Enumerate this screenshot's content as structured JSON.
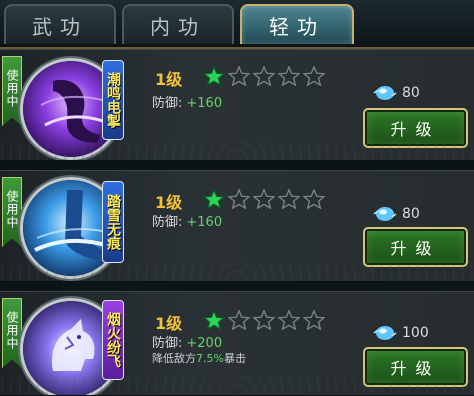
{
  "tabs": [
    {
      "label": "武功",
      "active": false
    },
    {
      "label": "内功",
      "active": false
    },
    {
      "label": "轻功",
      "active": true
    }
  ],
  "skills": [
    {
      "in_use_label": "使用中",
      "name": "潮鸣电掣",
      "level": "1级",
      "stars_filled": 1,
      "stars_total": 5,
      "stat_label": "防御:",
      "stat_value": "+160",
      "extra_prefix": "",
      "extra_percent": "",
      "extra_suffix": "",
      "cost": "80",
      "upgrade_label": "升级",
      "emblem_color": "#7a3fd0"
    },
    {
      "in_use_label": "使用中",
      "name": "踏雪无痕",
      "level": "1级",
      "stars_filled": 1,
      "stars_total": 5,
      "stat_label": "防御:",
      "stat_value": "+160",
      "extra_prefix": "",
      "extra_percent": "",
      "extra_suffix": "",
      "cost": "80",
      "upgrade_label": "升级",
      "emblem_color": "#2a8ee0"
    },
    {
      "in_use_label": "使用中",
      "name": "烟火纷飞",
      "level": "1级",
      "stars_filled": 1,
      "stars_total": 5,
      "stat_label": "防御:",
      "stat_value": "+200",
      "extra_prefix": "降低敌方",
      "extra_percent": "7.5%",
      "extra_suffix": "暴击",
      "cost": "100",
      "upgrade_label": "升级",
      "emblem_color": "#5a3cc8"
    }
  ],
  "colors": {
    "star_filled": "#2fd15a",
    "star_empty": "#7b8487",
    "level_gold": "#f1c23a",
    "stat_green": "#65d36a"
  },
  "icons": {
    "tab_bar": "tab-bar",
    "gem": "gem-icon",
    "star": "star-icon"
  }
}
